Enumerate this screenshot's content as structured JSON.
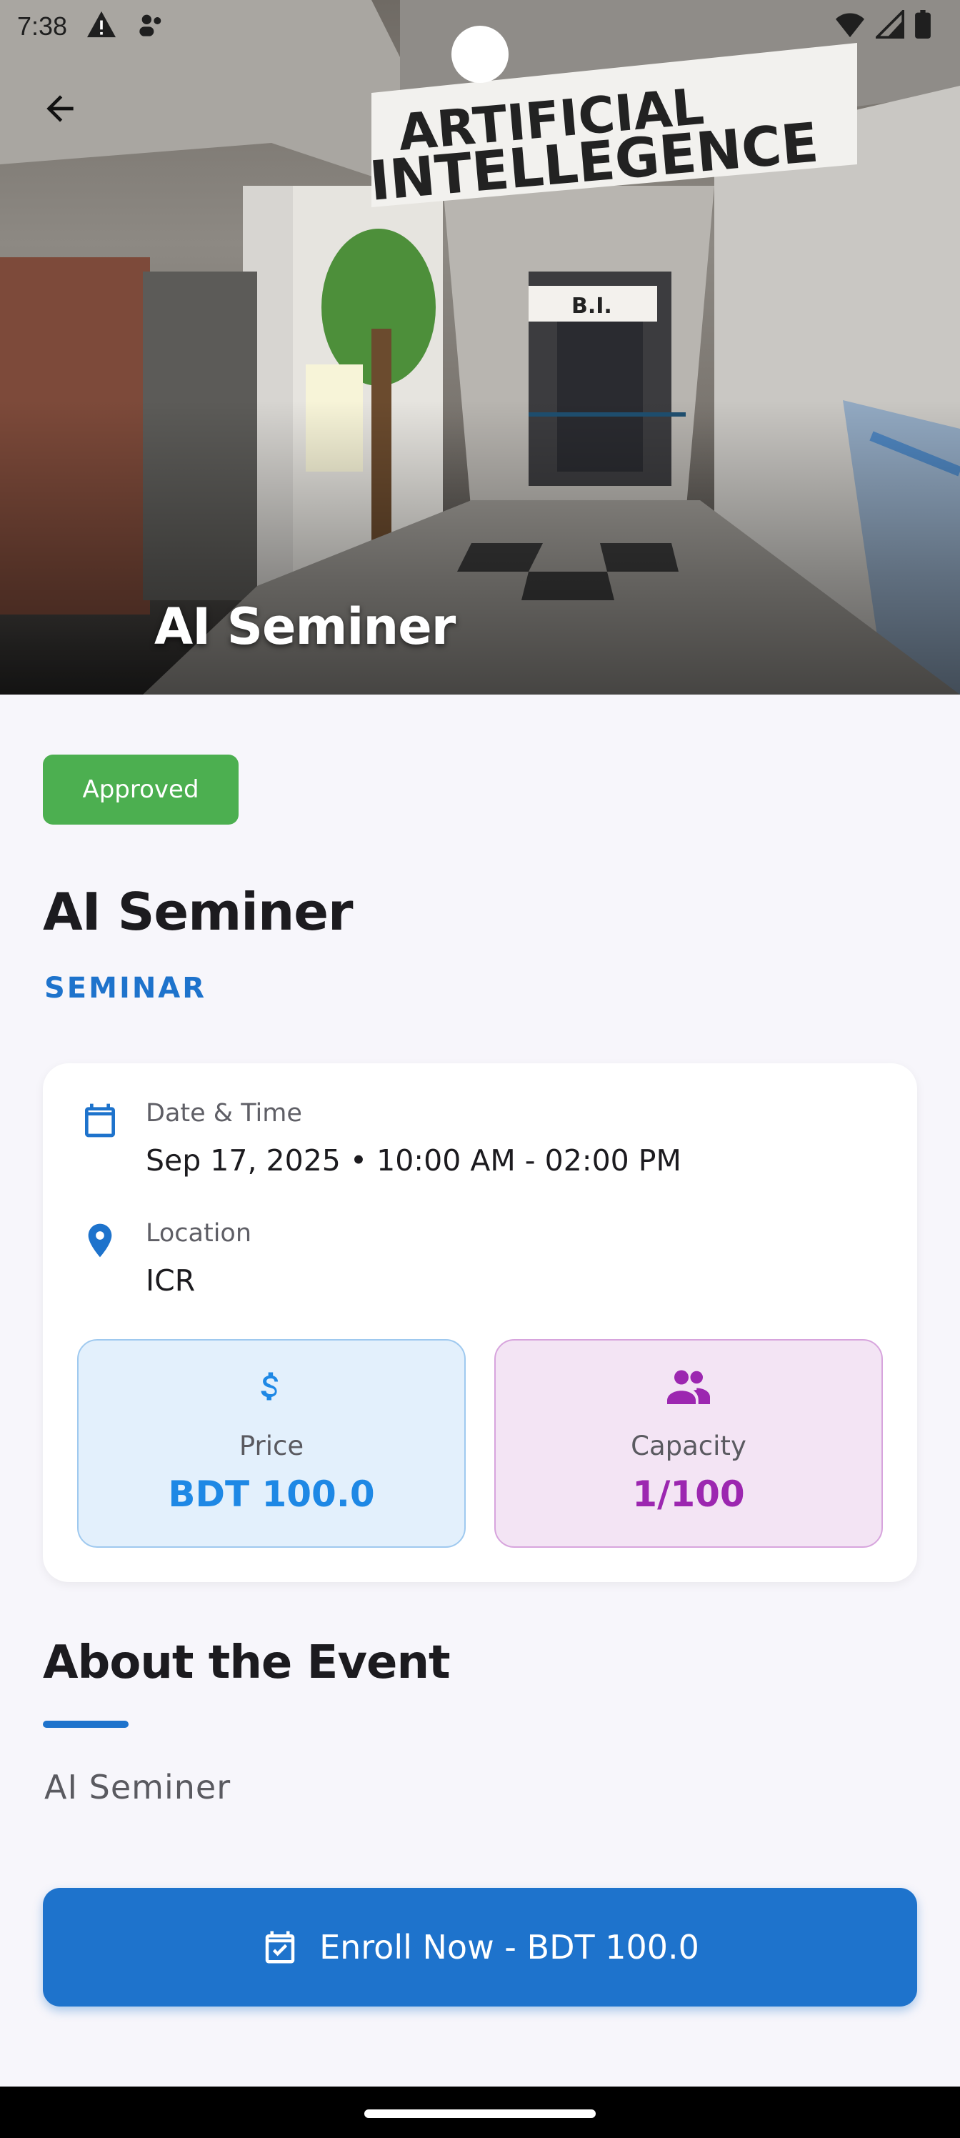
{
  "status_bar": {
    "time": "7:38"
  },
  "hero": {
    "title": "AI Seminer",
    "photo_signs": {
      "sign_main_1": "ARTIFICIAL",
      "sign_main_2": "INTELLEGENCE",
      "sign_door": "B.I."
    }
  },
  "event": {
    "status_badge": "Approved",
    "title": "AI Seminer",
    "category": "SEMINAR"
  },
  "details": {
    "date_label": "Date & Time",
    "date_value": "Sep 17, 2025 • 10:00 AM - 02:00 PM",
    "location_label": "Location",
    "location_value": "ICR",
    "price": {
      "icon": "dollar-icon",
      "label": "Price",
      "value": "BDT 100.0"
    },
    "capacity": {
      "icon": "people-icon",
      "label": "Capacity",
      "value": "1/100"
    }
  },
  "about": {
    "heading": "About the Event",
    "description": "AI Seminer"
  },
  "enroll_button": {
    "icon": "calendar-check-icon",
    "label": "Enroll Now - BDT 100.0"
  },
  "colors": {
    "primary": "#1e73cc",
    "approved": "#4caf50",
    "price_accent": "#1e88e5",
    "capacity_accent": "#9c27b0",
    "background": "#f7f6fb"
  }
}
